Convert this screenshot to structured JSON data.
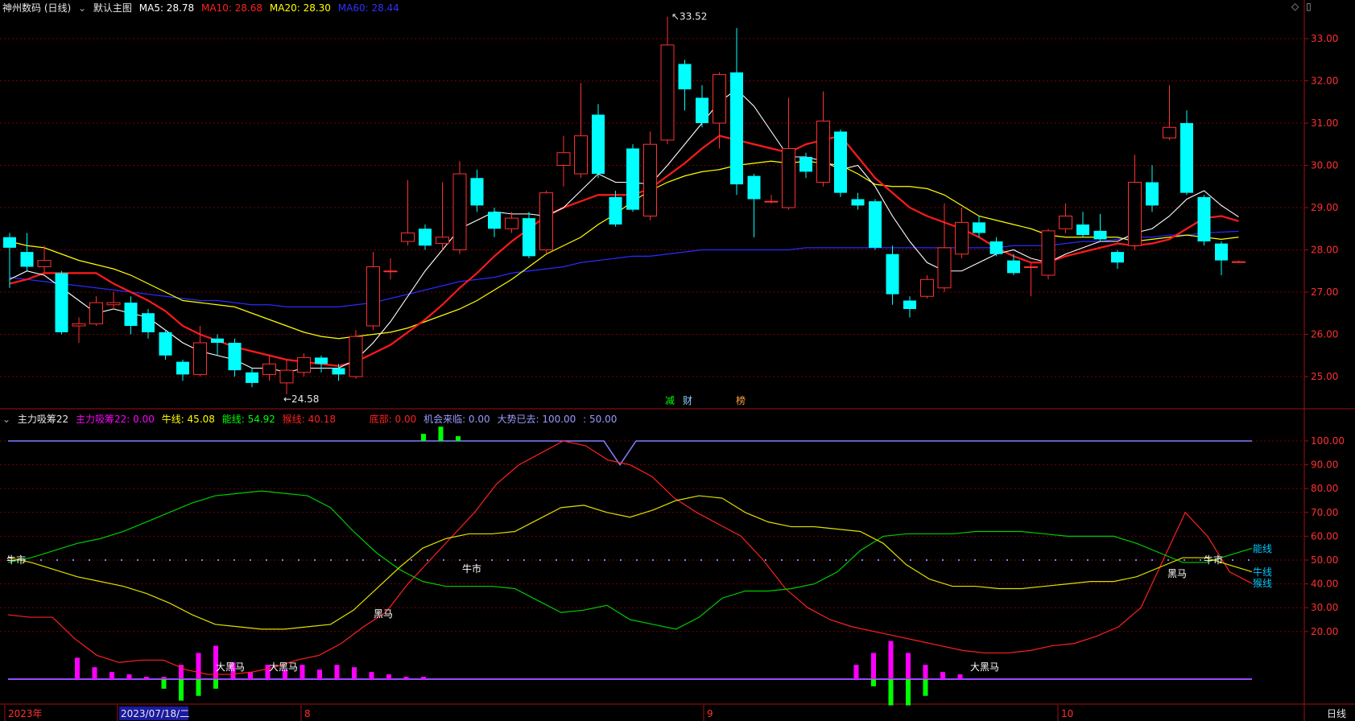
{
  "header": {
    "stock_name": "神州数码 (日线)",
    "chart_label": "默认主图",
    "ma": [
      {
        "label": "MA5: 28.78",
        "color": "#ffffff"
      },
      {
        "label": "MA10: 28.68",
        "color": "#ff2020"
      },
      {
        "label": "MA20: 28.30",
        "color": "#ffff00"
      },
      {
        "label": "MA60: 28.44",
        "color": "#2020ff"
      }
    ]
  },
  "indicator_header": {
    "name": "主力吸筹22",
    "values": [
      {
        "label": "主力吸筹22: 0.00",
        "color": "#ff00ff"
      },
      {
        "label": "牛线: 45.08",
        "color": "#ffff00"
      },
      {
        "label": "能线: 54.92",
        "color": "#00ff00"
      },
      {
        "label": "猴线: 40.18",
        "color": "#ff2020"
      },
      {
        "label": "底部: 0.00",
        "color": "#ff2020"
      },
      {
        "label": "机会来临: 0.00",
        "color": "#9a9aff"
      },
      {
        "label": "大势已去: 100.00",
        "color": "#9a9aff"
      },
      {
        "label": ": 50.00",
        "color": "#9a9aff"
      }
    ]
  },
  "price_axis": {
    "ticks": [
      "33.00",
      "32.00",
      "31.00",
      "30.00",
      "29.00",
      "28.00",
      "27.00",
      "26.00",
      "25.00"
    ]
  },
  "indicator_axis": {
    "ticks": [
      "100.00",
      "90.00",
      "80.00",
      "70.00",
      "60.00",
      "50.00",
      "40.00",
      "30.00",
      "20.00"
    ]
  },
  "x_axis": {
    "labels": [
      "2023年",
      "2023/07/18/二",
      "8",
      "9",
      "10"
    ],
    "period": "日线"
  },
  "annotations": {
    "high": "33.52",
    "low": "24.58",
    "markers": [
      "减",
      "财",
      "榜"
    ],
    "indicator_texts": [
      "牛市",
      "牛市",
      "牛市",
      "黑马",
      "黑马",
      "大黑马",
      "大黑马",
      "大黑马"
    ],
    "right_labels": [
      "能线",
      "牛线",
      "猴线"
    ]
  },
  "colors": {
    "up": "#ff3030",
    "down": "#00ffff",
    "grid": "#7a0000",
    "axis": "#a01010"
  },
  "chart_data": {
    "type": "candlestick",
    "ylim": [
      24.0,
      33.7
    ],
    "candles": [
      {
        "o": 28.3,
        "c": 28.05,
        "h": 28.4,
        "l": 27.1
      },
      {
        "o": 27.95,
        "c": 27.6,
        "h": 28.4,
        "l": 27.5
      },
      {
        "o": 27.6,
        "c": 27.75,
        "h": 28.1,
        "l": 27.4
      },
      {
        "o": 27.45,
        "c": 26.05,
        "h": 27.5,
        "l": 26.0
      },
      {
        "o": 26.2,
        "c": 26.25,
        "h": 26.4,
        "l": 25.8
      },
      {
        "o": 26.25,
        "c": 26.75,
        "h": 26.9,
        "l": 26.2
      },
      {
        "o": 26.7,
        "c": 26.75,
        "h": 27.0,
        "l": 26.6
      },
      {
        "o": 26.75,
        "c": 26.2,
        "h": 26.9,
        "l": 26.0
      },
      {
        "o": 26.5,
        "c": 26.05,
        "h": 26.6,
        "l": 25.9
      },
      {
        "o": 26.05,
        "c": 25.5,
        "h": 26.1,
        "l": 25.4
      },
      {
        "o": 25.35,
        "c": 25.05,
        "h": 25.4,
        "l": 24.9
      },
      {
        "o": 25.05,
        "c": 25.8,
        "h": 26.2,
        "l": 25.0
      },
      {
        "o": 25.9,
        "c": 25.8,
        "h": 26.0,
        "l": 25.5
      },
      {
        "o": 25.8,
        "c": 25.15,
        "h": 25.9,
        "l": 25.0
      },
      {
        "o": 25.1,
        "c": 24.85,
        "h": 25.2,
        "l": 24.75
      },
      {
        "o": 25.05,
        "c": 25.3,
        "h": 25.5,
        "l": 24.9
      },
      {
        "o": 24.85,
        "c": 25.15,
        "h": 25.4,
        "l": 24.58
      },
      {
        "o": 25.1,
        "c": 25.45,
        "h": 25.55,
        "l": 25.0
      },
      {
        "o": 25.45,
        "c": 25.3,
        "h": 25.5,
        "l": 25.1
      },
      {
        "o": 25.2,
        "c": 25.05,
        "h": 25.3,
        "l": 24.9
      },
      {
        "o": 25.0,
        "c": 25.95,
        "h": 26.1,
        "l": 24.95
      },
      {
        "o": 26.2,
        "c": 27.6,
        "h": 27.95,
        "l": 26.1
      },
      {
        "o": 27.5,
        "c": 27.5,
        "h": 27.8,
        "l": 27.3
      },
      {
        "o": 28.2,
        "c": 28.4,
        "h": 29.65,
        "l": 28.1
      },
      {
        "o": 28.5,
        "c": 28.1,
        "h": 28.6,
        "l": 28.0
      },
      {
        "o": 28.15,
        "c": 28.3,
        "h": 29.6,
        "l": 28.0
      },
      {
        "o": 28.0,
        "c": 29.8,
        "h": 30.1,
        "l": 27.9
      },
      {
        "o": 29.7,
        "c": 29.05,
        "h": 29.9,
        "l": 28.9
      },
      {
        "o": 28.9,
        "c": 28.5,
        "h": 29.0,
        "l": 28.3
      },
      {
        "o": 28.5,
        "c": 28.75,
        "h": 28.9,
        "l": 28.4
      },
      {
        "o": 28.75,
        "c": 27.85,
        "h": 28.9,
        "l": 27.8
      },
      {
        "o": 28.0,
        "c": 29.35,
        "h": 29.4,
        "l": 27.9
      },
      {
        "o": 30.0,
        "c": 30.3,
        "h": 30.7,
        "l": 29.5
      },
      {
        "o": 29.8,
        "c": 30.7,
        "h": 31.95,
        "l": 29.7
      },
      {
        "o": 31.2,
        "c": 29.8,
        "h": 31.45,
        "l": 29.7
      },
      {
        "o": 29.25,
        "c": 28.6,
        "h": 29.4,
        "l": 28.55
      },
      {
        "o": 30.4,
        "c": 28.95,
        "h": 30.5,
        "l": 28.9
      },
      {
        "o": 28.8,
        "c": 30.5,
        "h": 30.8,
        "l": 28.7
      },
      {
        "o": 30.6,
        "c": 32.85,
        "h": 33.52,
        "l": 30.5
      },
      {
        "o": 32.4,
        "c": 31.8,
        "h": 32.5,
        "l": 31.3
      },
      {
        "o": 31.6,
        "c": 31.0,
        "h": 31.9,
        "l": 30.9
      },
      {
        "o": 31.0,
        "c": 32.15,
        "h": 32.2,
        "l": 30.4
      },
      {
        "o": 32.2,
        "c": 29.55,
        "h": 33.25,
        "l": 29.3
      },
      {
        "o": 29.75,
        "c": 29.2,
        "h": 29.8,
        "l": 28.3
      },
      {
        "o": 29.15,
        "c": 29.15,
        "h": 29.3,
        "l": 29.1
      },
      {
        "o": 29.0,
        "c": 30.4,
        "h": 31.6,
        "l": 28.95
      },
      {
        "o": 30.2,
        "c": 29.85,
        "h": 30.3,
        "l": 29.7
      },
      {
        "o": 29.6,
        "c": 31.05,
        "h": 31.75,
        "l": 29.5
      },
      {
        "o": 30.8,
        "c": 29.35,
        "h": 30.85,
        "l": 29.25
      },
      {
        "o": 29.2,
        "c": 29.05,
        "h": 29.35,
        "l": 28.95
      },
      {
        "o": 29.15,
        "c": 28.05,
        "h": 29.2,
        "l": 28.0
      },
      {
        "o": 27.9,
        "c": 26.95,
        "h": 28.1,
        "l": 26.7
      },
      {
        "o": 26.8,
        "c": 26.6,
        "h": 26.9,
        "l": 26.4
      },
      {
        "o": 26.9,
        "c": 27.3,
        "h": 27.4,
        "l": 26.85
      },
      {
        "o": 27.1,
        "c": 28.05,
        "h": 29.1,
        "l": 27.0
      },
      {
        "o": 27.9,
        "c": 28.65,
        "h": 29.0,
        "l": 27.8
      },
      {
        "o": 28.65,
        "c": 28.4,
        "h": 28.8,
        "l": 28.3
      },
      {
        "o": 28.2,
        "c": 27.9,
        "h": 28.3,
        "l": 27.85
      },
      {
        "o": 27.75,
        "c": 27.45,
        "h": 27.9,
        "l": 27.4
      },
      {
        "o": 27.6,
        "c": 27.6,
        "h": 27.7,
        "l": 26.9
      },
      {
        "o": 27.4,
        "c": 28.45,
        "h": 28.5,
        "l": 27.3
      },
      {
        "o": 28.5,
        "c": 28.8,
        "h": 29.1,
        "l": 28.4
      },
      {
        "o": 28.6,
        "c": 28.35,
        "h": 28.9,
        "l": 28.3
      },
      {
        "o": 28.45,
        "c": 28.25,
        "h": 28.85,
        "l": 28.2
      },
      {
        "o": 27.95,
        "c": 27.7,
        "h": 28.0,
        "l": 27.55
      },
      {
        "o": 28.1,
        "c": 29.6,
        "h": 30.25,
        "l": 28.0
      },
      {
        "o": 29.6,
        "c": 29.05,
        "h": 30.0,
        "l": 28.9
      },
      {
        "o": 30.65,
        "c": 30.9,
        "h": 31.9,
        "l": 30.6
      },
      {
        "o": 31.0,
        "c": 29.35,
        "h": 31.3,
        "l": 29.3
      },
      {
        "o": 29.25,
        "c": 28.2,
        "h": 29.3,
        "l": 28.1
      },
      {
        "o": 28.15,
        "c": 27.75,
        "h": 28.2,
        "l": 27.4
      },
      {
        "o": 27.72,
        "c": 27.72,
        "h": 27.75,
        "l": 27.7
      }
    ],
    "ma5": [
      27.3,
      27.5,
      27.4,
      27.1,
      26.8,
      26.5,
      26.6,
      26.5,
      26.4,
      26.1,
      25.8,
      25.6,
      25.5,
      25.4,
      25.2,
      25.2,
      25.1,
      25.2,
      25.2,
      25.2,
      25.4,
      25.8,
      26.3,
      26.9,
      27.5,
      28.0,
      28.5,
      28.7,
      28.9,
      28.85,
      28.85,
      28.8,
      29.0,
      29.4,
      29.8,
      29.6,
      29.6,
      29.55,
      30.0,
      30.5,
      31.0,
      31.5,
      31.8,
      31.4,
      30.8,
      30.2,
      30.2,
      30.1,
      29.9,
      30.0,
      29.5,
      28.8,
      28.2,
      27.7,
      27.5,
      27.5,
      27.7,
      27.9,
      28.0,
      27.8,
      27.7,
      27.9,
      28.05,
      28.2,
      28.2,
      28.4,
      28.5,
      28.8,
      29.2,
      29.4,
      29.05,
      28.78
    ],
    "ma10": [
      27.2,
      27.3,
      27.45,
      27.45,
      27.45,
      27.45,
      27.2,
      27.0,
      26.8,
      26.55,
      26.2,
      26.0,
      25.85,
      25.7,
      25.6,
      25.5,
      25.4,
      25.35,
      25.3,
      25.25,
      25.35,
      25.55,
      25.75,
      26.05,
      26.35,
      26.7,
      27.1,
      27.45,
      27.85,
      28.2,
      28.5,
      28.8,
      29.0,
      29.15,
      29.3,
      29.3,
      29.3,
      29.45,
      29.75,
      30.05,
      30.4,
      30.7,
      30.6,
      30.5,
      30.4,
      30.3,
      30.5,
      30.6,
      30.7,
      30.2,
      29.7,
      29.35,
      29.0,
      28.8,
      28.65,
      28.5,
      28.3,
      28.05,
      27.85,
      27.7,
      27.7,
      27.85,
      27.95,
      28.05,
      28.15,
      28.1,
      28.15,
      28.25,
      28.5,
      28.75,
      28.8,
      28.68
    ],
    "ma20": [
      28.2,
      28.1,
      28.05,
      27.9,
      27.75,
      27.65,
      27.55,
      27.4,
      27.2,
      27.0,
      26.8,
      26.75,
      26.7,
      26.65,
      26.5,
      26.35,
      26.2,
      26.05,
      25.95,
      25.9,
      25.95,
      26.0,
      26.05,
      26.15,
      26.3,
      26.45,
      26.6,
      26.8,
      27.05,
      27.3,
      27.6,
      27.9,
      28.1,
      28.3,
      28.6,
      28.85,
      29.15,
      29.4,
      29.6,
      29.75,
      29.85,
      29.9,
      30.0,
      30.05,
      30.1,
      30.05,
      30.1,
      30.05,
      30.0,
      29.8,
      29.55,
      29.5,
      29.5,
      29.45,
      29.3,
      29.05,
      28.8,
      28.7,
      28.6,
      28.5,
      28.35,
      28.3,
      28.3,
      28.3,
      28.3,
      28.2,
      28.25,
      28.3,
      28.35,
      28.3,
      28.25,
      28.3
    ],
    "ma60": [
      27.35,
      27.3,
      27.25,
      27.2,
      27.15,
      27.1,
      27.05,
      27.0,
      26.95,
      26.9,
      26.85,
      26.8,
      26.8,
      26.75,
      26.7,
      26.7,
      26.65,
      26.65,
      26.65,
      26.65,
      26.7,
      26.75,
      26.85,
      26.95,
      27.05,
      27.15,
      27.25,
      27.3,
      27.35,
      27.45,
      27.5,
      27.55,
      27.6,
      27.7,
      27.75,
      27.8,
      27.85,
      27.85,
      27.9,
      27.95,
      28.0,
      28.0,
      28.0,
      28.0,
      28.0,
      28.0,
      28.05,
      28.05,
      28.05,
      28.05,
      28.05,
      28.05,
      28.05,
      28.05,
      28.05,
      28.05,
      28.05,
      28.05,
      28.1,
      28.1,
      28.1,
      28.15,
      28.2,
      28.2,
      28.25,
      28.3,
      28.3,
      28.35,
      28.35,
      28.4,
      28.42,
      28.44
    ],
    "ind_ylim": [
      -8,
      108
    ],
    "bull": [
      51,
      49,
      46,
      43,
      41,
      39,
      36,
      32,
      27,
      23,
      22,
      21,
      21,
      22,
      23,
      29,
      38,
      47,
      55,
      59,
      61,
      61,
      62,
      67,
      72,
      73,
      70,
      68,
      71,
      75,
      77,
      76,
      70,
      66,
      64,
      64,
      63,
      62,
      57,
      48,
      42,
      39,
      39,
      38,
      38,
      39,
      40,
      41,
      41,
      43,
      47,
      51,
      51,
      48,
      45.08
    ],
    "energy": [
      49,
      51,
      54,
      57,
      59,
      62,
      66,
      70,
      74,
      77,
      78,
      79,
      78,
      77,
      72,
      62,
      53,
      46,
      41,
      39,
      39,
      39,
      38,
      33,
      28,
      29,
      31,
      25,
      23,
      21,
      26,
      34,
      37,
      37,
      38,
      40,
      45,
      54,
      60,
      61,
      61,
      61,
      62,
      62,
      62,
      61,
      60,
      60,
      60,
      57,
      53,
      49,
      49,
      52,
      54.92
    ],
    "monkey": [
      27,
      26,
      26,
      17,
      10,
      7,
      8,
      8,
      4,
      2,
      2,
      3,
      5,
      8,
      10,
      15,
      22,
      28,
      40,
      50,
      60,
      70,
      82,
      90,
      95,
      100,
      98,
      92,
      90,
      85,
      76,
      70,
      65,
      60,
      50,
      38,
      30,
      25,
      22,
      20,
      18,
      16,
      14,
      12,
      11,
      11,
      12,
      14,
      15,
      18,
      22,
      30,
      50,
      70,
      60,
      45,
      40.18
    ],
    "mag_bars": [
      [
        4,
        9
      ],
      [
        5,
        5
      ],
      [
        6,
        3
      ],
      [
        7,
        2
      ],
      [
        8,
        1
      ],
      [
        9,
        1
      ],
      [
        10,
        6
      ],
      [
        11,
        11
      ],
      [
        12,
        14
      ],
      [
        13,
        7
      ],
      [
        14,
        3
      ],
      [
        15,
        6
      ],
      [
        16,
        4
      ],
      [
        17,
        6
      ],
      [
        18,
        4
      ],
      [
        19,
        6
      ],
      [
        20,
        5
      ],
      [
        21,
        3
      ],
      [
        22,
        2
      ],
      [
        23,
        1
      ],
      [
        24,
        1
      ],
      [
        49,
        6
      ],
      [
        50,
        11
      ],
      [
        51,
        16
      ],
      [
        52,
        11
      ],
      [
        53,
        6
      ],
      [
        54,
        3
      ],
      [
        55,
        2
      ]
    ],
    "green_bars": [
      [
        9,
        -4
      ],
      [
        10,
        -9
      ],
      [
        11,
        -7
      ],
      [
        12,
        -4
      ],
      [
        50,
        -3
      ],
      [
        51,
        -11
      ],
      [
        52,
        -11
      ],
      [
        53,
        -7
      ]
    ]
  }
}
